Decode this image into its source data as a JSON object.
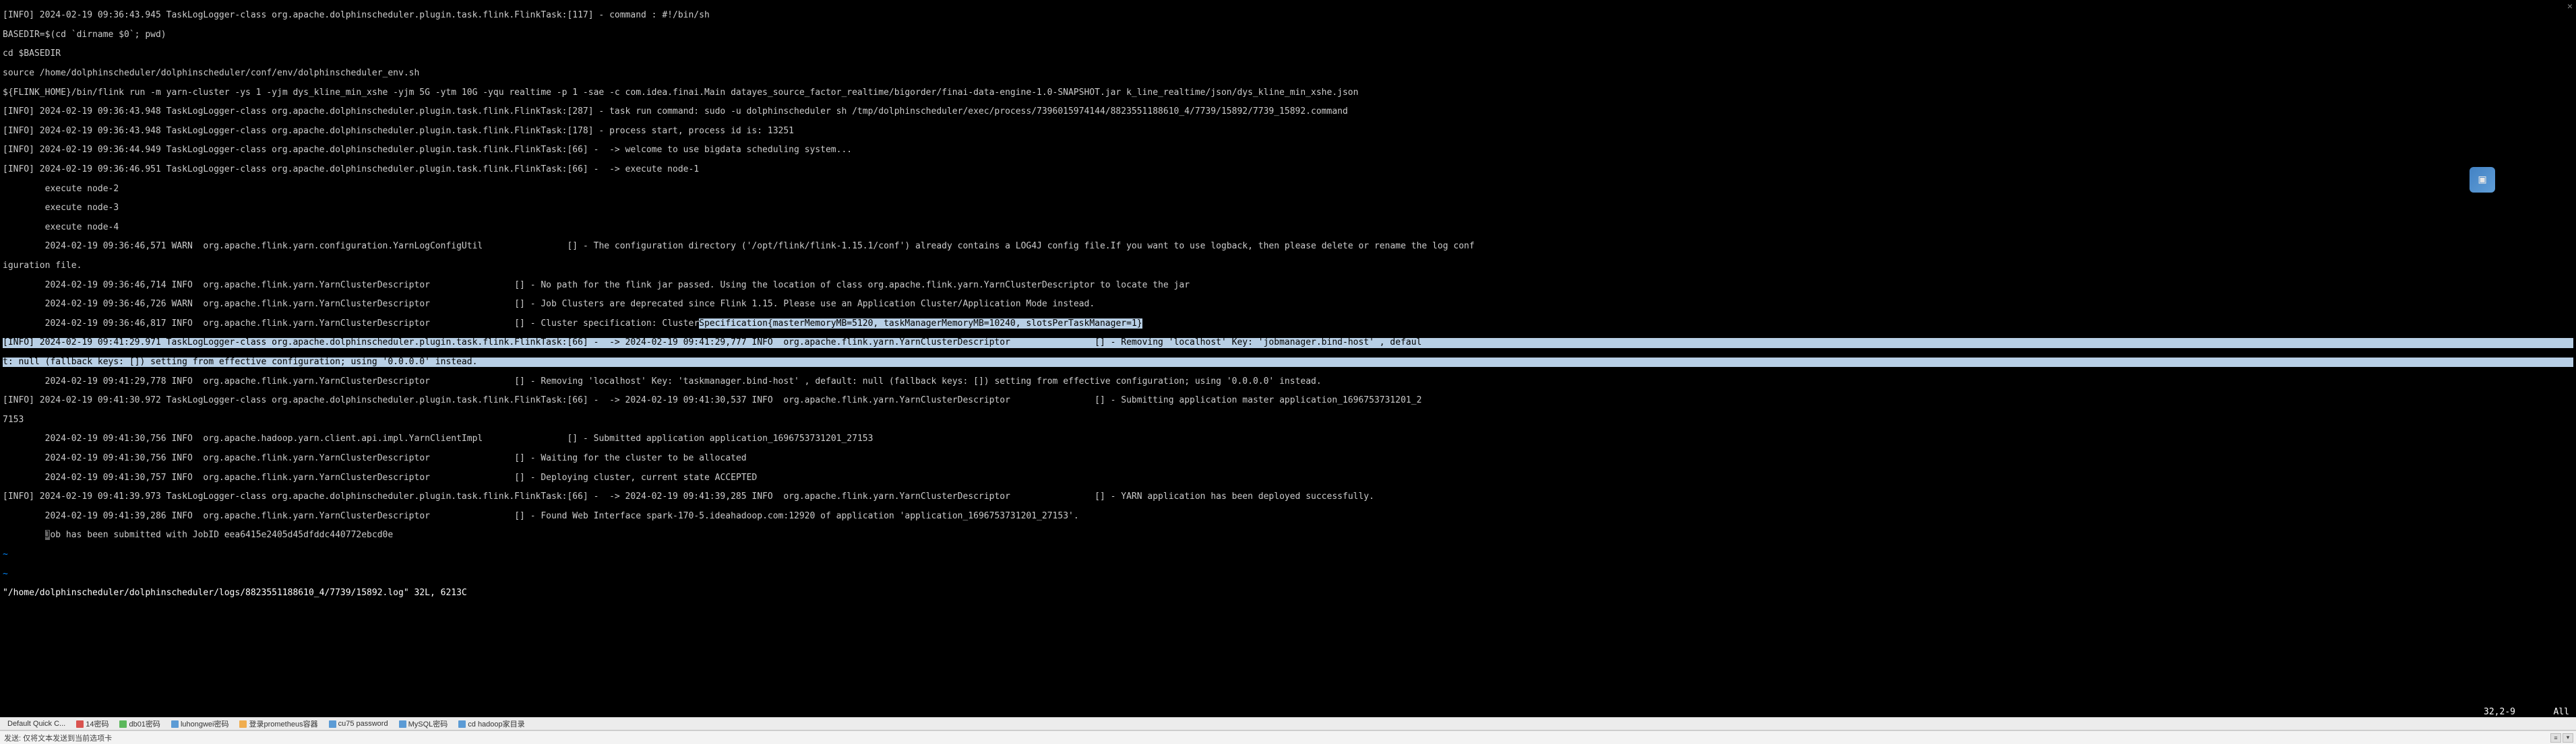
{
  "log": {
    "l0": "[INFO] 2024-02-19 09:36:43.945 TaskLogLogger-class org.apache.dolphinscheduler.plugin.task.flink.FlinkTask:[117] - command : #!/bin/sh",
    "l1": "BASEDIR=$(cd `dirname $0`; pwd)",
    "l2": "cd $BASEDIR",
    "l3": "source /home/dolphinscheduler/dolphinscheduler/conf/env/dolphinscheduler_env.sh",
    "l4": "${FLINK_HOME}/bin/flink run -m yarn-cluster -ys 1 -yjm dys_kline_min_xshe -yjm 5G -ytm 10G -yqu realtime -p 1 -sae -c com.idea.finai.Main datayes_source_factor_realtime/bigorder/finai-data-engine-1.0-SNAPSHOT.jar k_line_realtime/json/dys_kline_min_xshe.json",
    "l5": "[INFO] 2024-02-19 09:36:43.948 TaskLogLogger-class org.apache.dolphinscheduler.plugin.task.flink.FlinkTask:[287] - task run command: sudo -u dolphinscheduler sh /tmp/dolphinscheduler/exec/process/7396015974144/8823551188610_4/7739/15892/7739_15892.command",
    "l6": "[INFO] 2024-02-19 09:36:43.948 TaskLogLogger-class org.apache.dolphinscheduler.plugin.task.flink.FlinkTask:[178] - process start, process id is: 13251",
    "l7": "[INFO] 2024-02-19 09:36:44.949 TaskLogLogger-class org.apache.dolphinscheduler.plugin.task.flink.FlinkTask:[66] -  -> welcome to use bigdata scheduling system...",
    "l8": "[INFO] 2024-02-19 09:36:46.951 TaskLogLogger-class org.apache.dolphinscheduler.plugin.task.flink.FlinkTask:[66] -  -> execute node-1",
    "l9": "\texecute node-2",
    "l10": "\texecute node-3",
    "l11": "\texecute node-4",
    "l12a": "\t2024-02-19 09:36:46,571 WARN  org.apache.flink.yarn.configuration.YarnLogConfigUtil",
    "l12b": "[] - The configuration directory ('/opt/flink/flink-1.15.1/conf') already contains a LOG4J config file.If you want to use logback, then please delete or rename the log conf",
    "l13": "iguration file.",
    "l14a": "\t2024-02-19 09:36:46,714 INFO  org.apache.flink.yarn.YarnClusterDescriptor",
    "l14b": "[] - No path for the flink jar passed. Using the location of class org.apache.flink.yarn.YarnClusterDescriptor to locate the jar",
    "l15a": "\t2024-02-19 09:36:46,726 WARN  org.apache.flink.yarn.YarnClusterDescriptor",
    "l15b": "[] - Job Clusters are deprecated since Flink 1.15. Please use an Application Cluster/Application Mode instead.",
    "l16a": "\t2024-02-19 09:36:46,817 INFO  org.apache.flink.yarn.YarnClusterDescriptor",
    "l16b": "[] - Cluster specification: Cluster",
    "l16c": "Specification{masterMemoryMB=5120, taskManagerMemoryMB=10240, slotsPerTaskManager=1}",
    "l17a": "[INFO] 2024-02-19 09:41:29.971 TaskLogLogger-class org.apache.dolphinscheduler.plugin.task.flink.FlinkTask:[66] -  -> 2024-02-19 09:41:29,777 INFO  org.apache.flink.yarn.YarnClusterDescriptor",
    "l17b": "                [] - Removing 'localhost' Key: 'jobmanager.bind-host' , defaul",
    "l18": "t: null (fallback keys: []) setting from effective configuration; using '0.0.0.0' instead.",
    "l19a": "\t2024-02-19 09:41:29,778 INFO  org.apache.flink.yarn.YarnClusterDescriptor",
    "l19b": "[] - Removing 'localhost' Key: 'taskmanager.bind-host' , default: null (fallback keys: []) setting from effective configuration; using '0.0.0.0' instead.",
    "l20a": "[INFO] 2024-02-19 09:41:30.972 TaskLogLogger-class org.apache.dolphinscheduler.plugin.task.flink.FlinkTask:[66] -  -> 2024-02-19 09:41:30,537 INFO  org.apache.flink.yarn.YarnClusterDescriptor",
    "l20b": "[] - Submitting application master application_1696753731201_2",
    "l21": "7153",
    "l22a": "\t2024-02-19 09:41:30,756 INFO  org.apache.hadoop.yarn.client.api.impl.YarnClientImpl",
    "l22b": "[] - Submitted application application_1696753731201_27153",
    "l23a": "\t2024-02-19 09:41:30,756 INFO  org.apache.flink.yarn.YarnClusterDescriptor",
    "l23b": "[] - Waiting for the cluster to be allocated",
    "l24a": "\t2024-02-19 09:41:30,757 INFO  org.apache.flink.yarn.YarnClusterDescriptor",
    "l24b": "[] - Deploying cluster, current state ACCEPTED",
    "l25a": "[INFO] 2024-02-19 09:41:39.973 TaskLogLogger-class org.apache.dolphinscheduler.plugin.task.flink.FlinkTask:[66] -  -> 2024-02-19 09:41:39,285 INFO  org.apache.flink.yarn.YarnClusterDescriptor",
    "l25b": "[] - YARN application has been deployed successfully.",
    "l26a": "\t2024-02-19 09:41:39,286 INFO  org.apache.flink.yarn.YarnClusterDescriptor",
    "l26b": "[] - Found Web Interface spark-170-5.ideahadoop.com:12920 of application 'application_1696753731201_27153'.",
    "l27a": "\t",
    "l27b": "J",
    "l27c": "ob has been submitted with JobID eea6415e2405d45dfddc440772ebcd0e",
    "tilde": "~",
    "status": "\"/home/dolphinscheduler/dolphinscheduler/logs/8823551188610_4/7739/15892.log\" 32L, 6213C",
    "cursor": "32,2-9",
    "all": "All"
  },
  "toolbar": {
    "t0": "Default Quick C...",
    "t1": "14密码",
    "t2": "db01密码",
    "t3": "luhongwei密码",
    "t4": "登录prometheus容器",
    "t5": "cu75 password",
    "t6": "MySQL密码",
    "t7": "cd hadoop家目录"
  },
  "sendbar": {
    "label": "发送: 仅将文本发送到当前选项卡"
  },
  "pad": "                "
}
